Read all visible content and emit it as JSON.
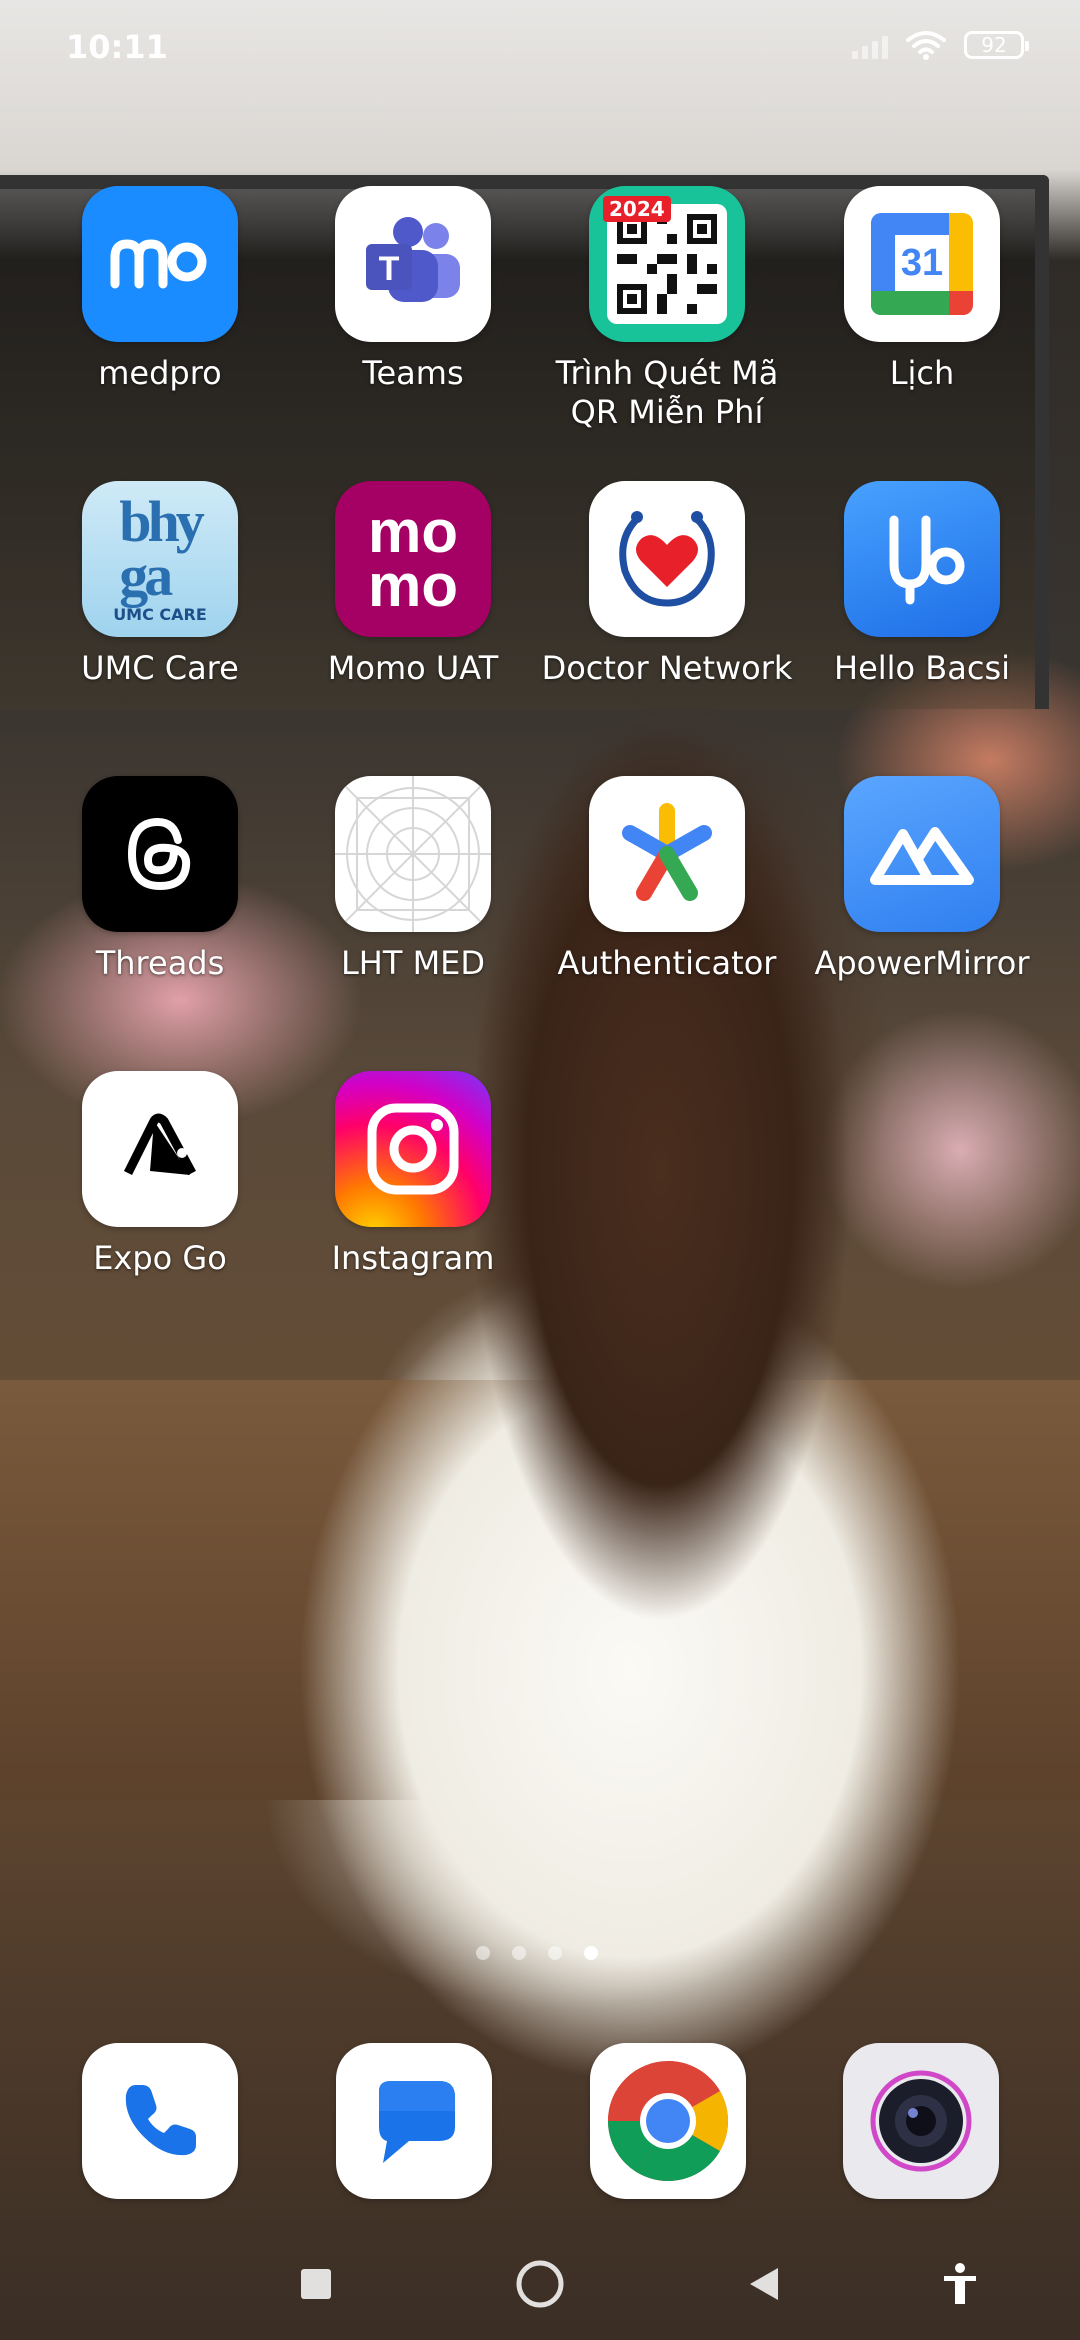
{
  "status_bar": {
    "time": "10:11",
    "battery": "92"
  },
  "apps": [
    {
      "label": "medpro",
      "icon": "medpro-icon"
    },
    {
      "label": "Teams",
      "icon": "teams-icon"
    },
    {
      "label": "Trình Quét Mã QR Miễn Phí",
      "icon": "qr-scanner-icon",
      "badge": "2024"
    },
    {
      "label": "Lịch",
      "icon": "calendar-icon",
      "date": "31"
    },
    {
      "label": "UMC Care",
      "icon": "umc-care-icon",
      "sub": "UMC CARE"
    },
    {
      "label": "Momo UAT",
      "icon": "momo-icon",
      "line1": "mo",
      "line2": "mo"
    },
    {
      "label": "Doctor Network",
      "icon": "doctor-network-icon"
    },
    {
      "label": "Hello Bacsi",
      "icon": "hello-bacsi-icon"
    },
    {
      "label": "Threads",
      "icon": "threads-icon"
    },
    {
      "label": "LHT MED",
      "icon": "lht-med-icon"
    },
    {
      "label": "Authenticator",
      "icon": "authenticator-icon"
    },
    {
      "label": "ApowerMirror",
      "icon": "apowermirror-icon"
    },
    {
      "label": "Expo Go",
      "icon": "expo-go-icon"
    },
    {
      "label": "Instagram",
      "icon": "instagram-icon"
    }
  ],
  "page_indicator": {
    "count": 4,
    "active": 4
  },
  "dock": [
    {
      "name": "phone",
      "icon": "phone-icon"
    },
    {
      "name": "messages",
      "icon": "messages-icon"
    },
    {
      "name": "chrome",
      "icon": "chrome-icon"
    },
    {
      "name": "camera",
      "icon": "camera-icon"
    }
  ],
  "colors": {
    "medpro": "#1a8cff",
    "momo": "#a50064",
    "apowermirror": "#3d8cf5",
    "hello_bacsi": "#2f7cf0"
  }
}
